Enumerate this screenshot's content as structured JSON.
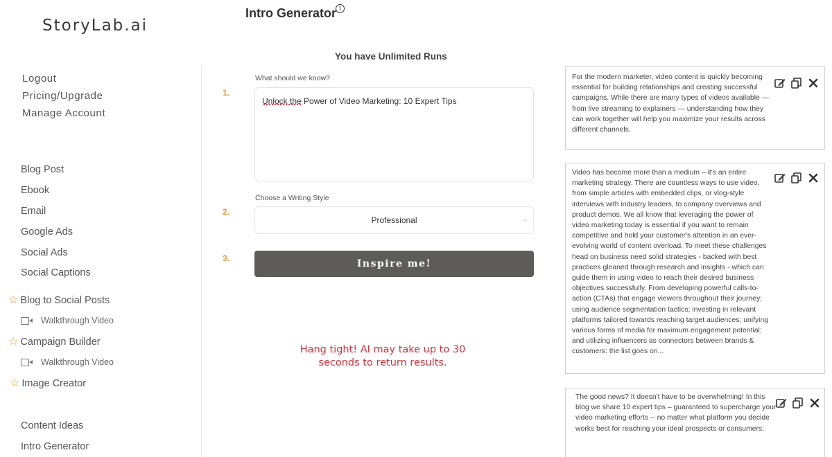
{
  "brand": {
    "logo": "StoryLab.ai"
  },
  "account_menu": [
    "Logout",
    "Pricing/Upgrade",
    "Manage Account"
  ],
  "tools": {
    "blog_post": "Blog Post",
    "ebook": "Ebook",
    "email": "Email",
    "google_ads": "Google Ads",
    "social_ads": "Social Ads",
    "social_captions": "Social Captions",
    "blog_to_social": "Blog to Social Posts",
    "walkthrough_1": "Walkthrough Video",
    "campaign_builder": "Campaign Builder",
    "walkthrough_2": "Walkthrough Video",
    "image_creator": "Image Creator",
    "content_ideas": "Content Ideas",
    "intro_generator": "Intro Generator"
  },
  "header": {
    "title": "Intro Generator",
    "info": "i"
  },
  "runs": "You have Unlimited Runs",
  "form": {
    "step1": "1.",
    "step2": "2.",
    "step3": "3.",
    "know_label": "What should we know?",
    "know_value": "Unlock the Power of Video Marketing: 10 Expert Tips",
    "style_label": "Choose a Writing Style",
    "style_value": "Professional",
    "button": "Inspire me!"
  },
  "wait_message": "Hang tight! AI may take up to 30 seconds to return results.",
  "results": [
    {
      "text": "For the modern marketer, video content is quickly becoming essential for building relationships and creating successful campaigns. While there are many types of videos available — from live streaming to explainers — understanding how they can work together will help you maximize your results across different channels."
    },
    {
      "text": "Video has become more than a medium – it's an entire marketing strategy. There are countless ways to use video, from simple articles with embedded clips, or vlog-style interviews with industry leaders, to company overviews and product demos. We all know that leveraging the power of video marketing today is essential if you want to remain competitive and hold your customer's attention in an ever-evolving world of content overload. To meet these challenges head on business need solid strategies - backed with best practices gleaned through research and insights - which can guide them in using video to reach their desired business objectives successfully. From developing powerful calls-to-action (CTAs) that engage viewers throughout their journey; using audience segmentation tactics; investing in relevant platforms tailored towards reaching target audiences; unifying various forms of media for maximum engagement potential; and utilizing influencers as connectors between brands & customers: the list goes on..."
    },
    {
      "text": "The good news? It doesn't have to be overwhelming! In this blog we share 10 expert tips – guaranteed to supercharge your video marketing efforts -- no matter what platform you decide works best for reaching your ideal prospects or consumers:"
    }
  ]
}
